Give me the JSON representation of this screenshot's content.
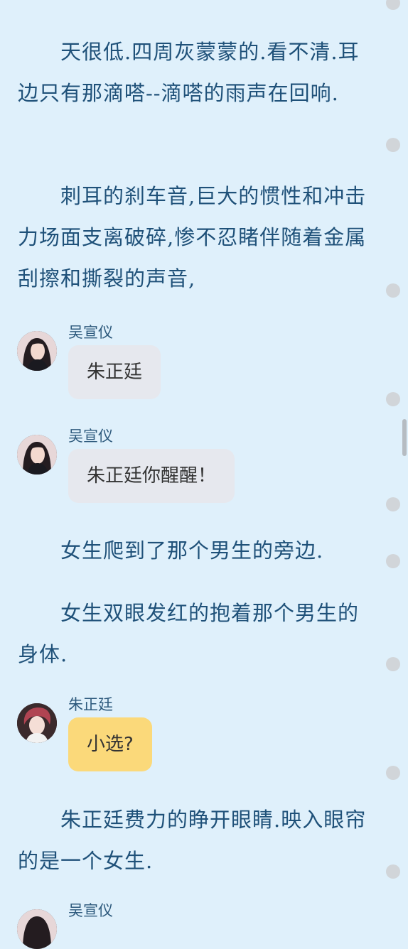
{
  "story": {
    "p1": "　　天很低.四周灰蒙蒙的.看不清.耳边只有那滴嗒--滴嗒的雨声在回响.",
    "p2": "　　刺耳的刹车音,巨大的惯性和冲击力场面支离破碎,惨不忍睹伴随着金属刮擦和撕裂的声音,",
    "p3": "　　女生爬到了那个男生的旁边.",
    "p4": "　　女生双眼发红的抱着那个男生的身体.",
    "p5": "　　朱正廷费力的睁开眼睛.映入眼帘的是一个女生."
  },
  "messages": [
    {
      "sender": "吴宣仪",
      "text": "朱正廷"
    },
    {
      "sender": "吴宣仪",
      "text": "朱正廷你醒醒！"
    },
    {
      "sender": "朱正廷",
      "text": "小选?"
    },
    {
      "sender": "吴宣仪"
    }
  ],
  "colors": {
    "background": "#dff0fb",
    "narration_text": "#1f5179",
    "bubble_grey": "#e6e8ee",
    "bubble_yellow": "#fbd97a"
  }
}
